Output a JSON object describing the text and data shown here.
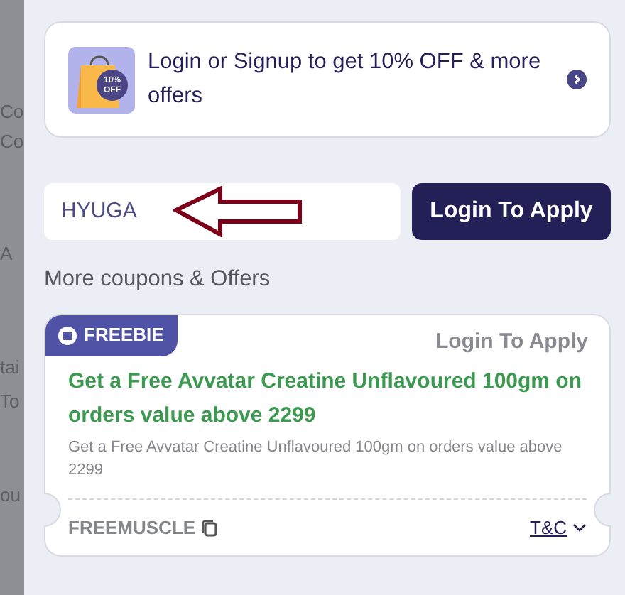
{
  "background_fragments": [
    {
      "text": "Co"
    },
    {
      "text": "Co"
    },
    {
      "text": "A"
    },
    {
      "text": "tai"
    },
    {
      "text": "To"
    },
    {
      "text": "ou"
    }
  ],
  "login_banner": {
    "text": "Login or Signup to get 10% OFF & more offers",
    "badge": "10% OFF"
  },
  "coupon_entry": {
    "value": "HYUGA",
    "button": "Login To Apply"
  },
  "section_title": "More coupons & Offers",
  "coupons": [
    {
      "tag": "FREEBIE",
      "action": "Login To Apply",
      "title": "Get a Free Avvatar Creatine Unflavoured 100gm on orders value above 2299",
      "description": "Get a Free Avvatar Creatine Unflavoured 100gm on orders value above 2299",
      "code": "FREEMUSCLE",
      "terms": "T&C"
    }
  ]
}
